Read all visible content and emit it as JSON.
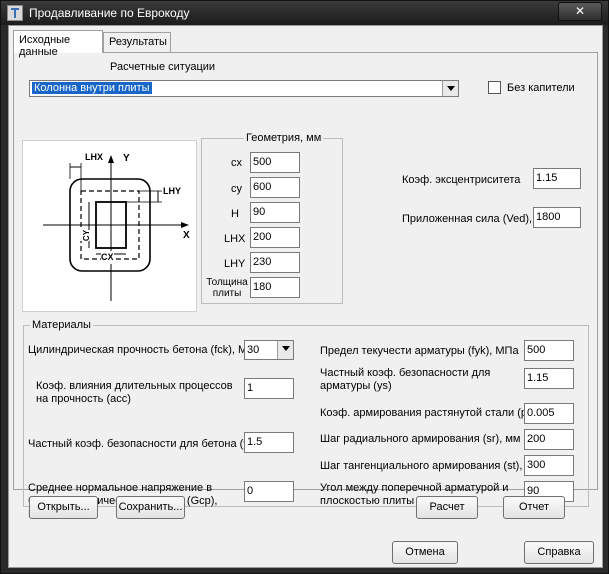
{
  "window": {
    "title": "Продавливание по Еврокоду",
    "close_label": "✕"
  },
  "tabs": [
    {
      "label": "Исходные данные"
    },
    {
      "label": "Результаты"
    }
  ],
  "situation": {
    "label": "Расчетные ситуации",
    "selected": "Колонна внутри плиты"
  },
  "no_capital": {
    "label": "Без капители",
    "checked": false
  },
  "diagram": {
    "lhx": "LHX",
    "lhy": "LHY",
    "y": "Y",
    "x": "X",
    "cx": "CX",
    "cy": "CY"
  },
  "geometry": {
    "title": "Геометрия, мм",
    "fields": [
      {
        "label": "cx",
        "value": "500"
      },
      {
        "label": "cy",
        "value": "600"
      },
      {
        "label": "H",
        "value": "90"
      },
      {
        "label": "LHX",
        "value": "200"
      },
      {
        "label": "LHY",
        "value": "230"
      },
      {
        "label": "Толщина плиты",
        "value": "180"
      }
    ]
  },
  "eccentricity": {
    "label": "Коэф. эксцентриситета",
    "value": "1.15"
  },
  "force": {
    "label": "Приложенная сила (Ved), кН",
    "value": "1800"
  },
  "materials": {
    "title": "Материалы",
    "fck": {
      "label": "Цилиндрическая прочность бетона (fck), МПа",
      "value": "30"
    },
    "acc": {
      "label": "Коэф. влияния длительных процессов на прочность (acc)",
      "value": "1"
    },
    "yc": {
      "label": "Частный коэф. безопасности для бетона (yc)",
      "value": "1.5"
    },
    "gcp": {
      "label": "Среднее нормальное напряжение в бетоне в критическом сечении (Gcp), МПа",
      "value": "0"
    },
    "fyk": {
      "label": "Предел текучести арматуры (fyk), МПа",
      "value": "500"
    },
    "ys": {
      "label": "Частный коэф. безопасности для арматуры (ys)",
      "value": "1.15"
    },
    "pl": {
      "label": "Коэф. армирования растянутой стали (pl)",
      "value": "0.005"
    },
    "sr": {
      "label": "Шаг радиального армирования (sr), мм",
      "value": "200"
    },
    "st": {
      "label": "Шаг тангенциального армирования (st), мм",
      "value": "300"
    },
    "alpha": {
      "label": "Угол между поперечной арматурой и плоскостью плиты (a), град",
      "value": "90"
    }
  },
  "buttons": {
    "open": "Открыть...",
    "save": "Сохранить...",
    "calc": "Расчет",
    "report": "Отчет",
    "cancel": "Отмена",
    "help": "Справка"
  }
}
